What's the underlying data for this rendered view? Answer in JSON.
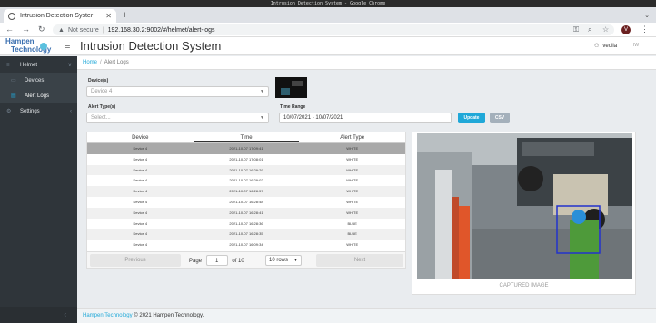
{
  "os": {
    "title": "Intrusion Detection System - Google Chrome"
  },
  "browser": {
    "tab_title": "Intrusion Detection Syster",
    "not_secure": "Not secure",
    "url": "192.168.30.2:9002/#/helmet/alert-logs",
    "profile_initial": "V"
  },
  "header": {
    "logo_line1": "Hampen",
    "logo_line2": "Technology",
    "title": "Intrusion Detection System",
    "user": "veolia",
    "lang": "IW"
  },
  "sidebar": {
    "items": [
      {
        "label": "Helmet",
        "icon": "helmet-icon"
      },
      {
        "label": "Devices",
        "icon": "devices-icon"
      },
      {
        "label": "Alert Logs",
        "icon": "alert-logs-icon"
      },
      {
        "label": "Settings",
        "icon": "settings-icon"
      }
    ],
    "minimize": "‹"
  },
  "breadcrumb": {
    "home": "Home",
    "current": "Alert Logs"
  },
  "filters": {
    "device_label": "Device(s)",
    "device_value": "Device 4",
    "alert_type_label": "Alert Type(s)",
    "alert_type_placeholder": "Select...",
    "time_range_label": "Time Range",
    "time_range_value": "10/07/2021 - 10/07/2021",
    "update_label": "Update",
    "csv_label": "CSV"
  },
  "colors": {
    "update": "#20a8d8",
    "csv": "#a4b0bb",
    "sidebar": "#2f353a",
    "link": "#20a8d8"
  },
  "table": {
    "columns": [
      "Device",
      "Time",
      "Alert Type"
    ],
    "rows": [
      [
        "Device 4",
        "2021-10-07 17:09:41",
        "WHITE"
      ],
      [
        "Device 4",
        "2021-10-07 17:08:01",
        "WHITE"
      ],
      [
        "Device 4",
        "2021-10-07 16:29:29",
        "WHITE"
      ],
      [
        "Device 4",
        "2021-10-07 16:29:02",
        "WHITE"
      ],
      [
        "Device 4",
        "2021-10-07 16:28:57",
        "WHITE"
      ],
      [
        "Device 4",
        "2021-10-07 16:28:48",
        "WHITE"
      ],
      [
        "Device 4",
        "2021-10-07 16:28:41",
        "WHITE"
      ],
      [
        "Device 4",
        "2021-10-07 16:28:36",
        "BLUE"
      ],
      [
        "Device 4",
        "2021-10-07 16:28:35",
        "BLUE"
      ],
      [
        "Device 4",
        "2021-10-07 16:09:34",
        "WHITE"
      ]
    ],
    "previous": "Previous",
    "next": "Next",
    "page_label": "Page",
    "page_value": "1",
    "of_label": "of 10",
    "rows_select": "10 rows"
  },
  "captured": {
    "label": "CAPTURED IMAGE"
  },
  "footer": {
    "brand": "Hampen Technology",
    "text": "© 2021 Hampen Technology."
  }
}
